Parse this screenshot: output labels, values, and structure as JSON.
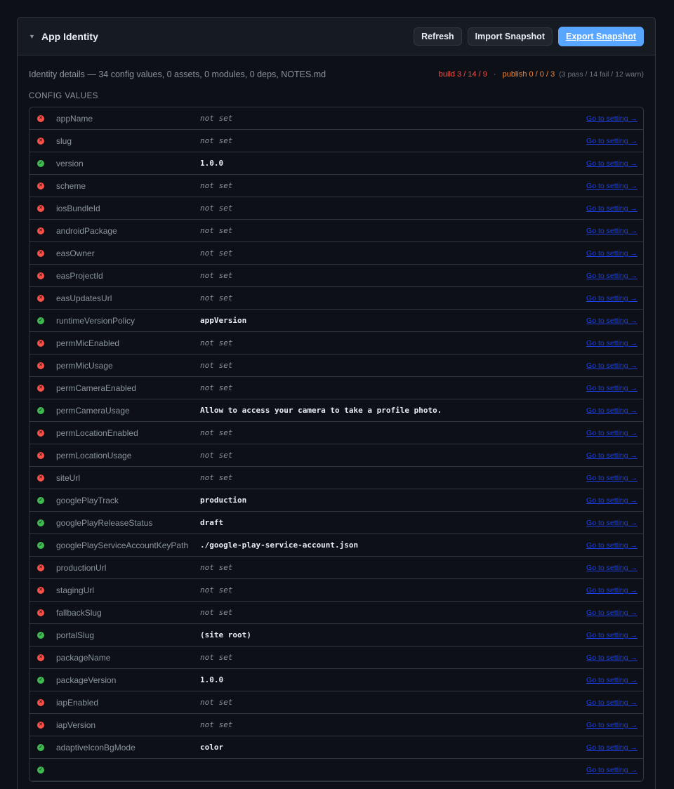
{
  "header": {
    "title": "App Identity",
    "buttons": {
      "refresh": "Refresh",
      "import": "Import Snapshot",
      "export": "Export Snapshot"
    }
  },
  "summary": {
    "description": "Identity details — 34 config values, 0 assets, 0 modules, 0 deps, NOTES.md",
    "build": "build 3 / 14 / 9",
    "separator": "·",
    "publish": "publish 0 / 0 / 3",
    "counts": "(3 pass / 14 fail / 12 warn)"
  },
  "section_title": "CONFIG VALUES",
  "link_label": "Go to setting →",
  "rows": [
    {
      "key": "appName",
      "value": "not set",
      "status": "fail"
    },
    {
      "key": "slug",
      "value": "not set",
      "status": "fail"
    },
    {
      "key": "version",
      "value": "1.0.0",
      "status": "pass"
    },
    {
      "key": "scheme",
      "value": "not set",
      "status": "fail"
    },
    {
      "key": "iosBundleId",
      "value": "not set",
      "status": "fail"
    },
    {
      "key": "androidPackage",
      "value": "not set",
      "status": "fail"
    },
    {
      "key": "easOwner",
      "value": "not set",
      "status": "fail"
    },
    {
      "key": "easProjectId",
      "value": "not set",
      "status": "fail"
    },
    {
      "key": "easUpdatesUrl",
      "value": "not set",
      "status": "fail"
    },
    {
      "key": "runtimeVersionPolicy",
      "value": "appVersion",
      "status": "pass"
    },
    {
      "key": "permMicEnabled",
      "value": "not set",
      "status": "fail"
    },
    {
      "key": "permMicUsage",
      "value": "not set",
      "status": "fail"
    },
    {
      "key": "permCameraEnabled",
      "value": "not set",
      "status": "fail"
    },
    {
      "key": "permCameraUsage",
      "value": "Allow to access your camera to take a profile photo.",
      "status": "pass"
    },
    {
      "key": "permLocationEnabled",
      "value": "not set",
      "status": "fail"
    },
    {
      "key": "permLocationUsage",
      "value": "not set",
      "status": "fail"
    },
    {
      "key": "siteUrl",
      "value": "not set",
      "status": "fail"
    },
    {
      "key": "googlePlayTrack",
      "value": "production",
      "status": "pass"
    },
    {
      "key": "googlePlayReleaseStatus",
      "value": "draft",
      "status": "pass"
    },
    {
      "key": "googlePlayServiceAccountKeyPath",
      "value": "./google-play-service-account.json",
      "status": "pass"
    },
    {
      "key": "productionUrl",
      "value": "not set",
      "status": "fail"
    },
    {
      "key": "stagingUrl",
      "value": "not set",
      "status": "fail"
    },
    {
      "key": "fallbackSlug",
      "value": "not set",
      "status": "fail"
    },
    {
      "key": "portalSlug",
      "value": "(site root)",
      "status": "pass"
    },
    {
      "key": "packageName",
      "value": "not set",
      "status": "fail"
    },
    {
      "key": "packageVersion",
      "value": "1.0.0",
      "status": "pass"
    },
    {
      "key": "iapEnabled",
      "value": "not set",
      "status": "fail"
    },
    {
      "key": "iapVersion",
      "value": "not set",
      "status": "fail"
    },
    {
      "key": "adaptiveIconBgMode",
      "value": "color",
      "status": "pass"
    },
    {
      "key": "",
      "value": "",
      "status": "pass"
    }
  ]
}
